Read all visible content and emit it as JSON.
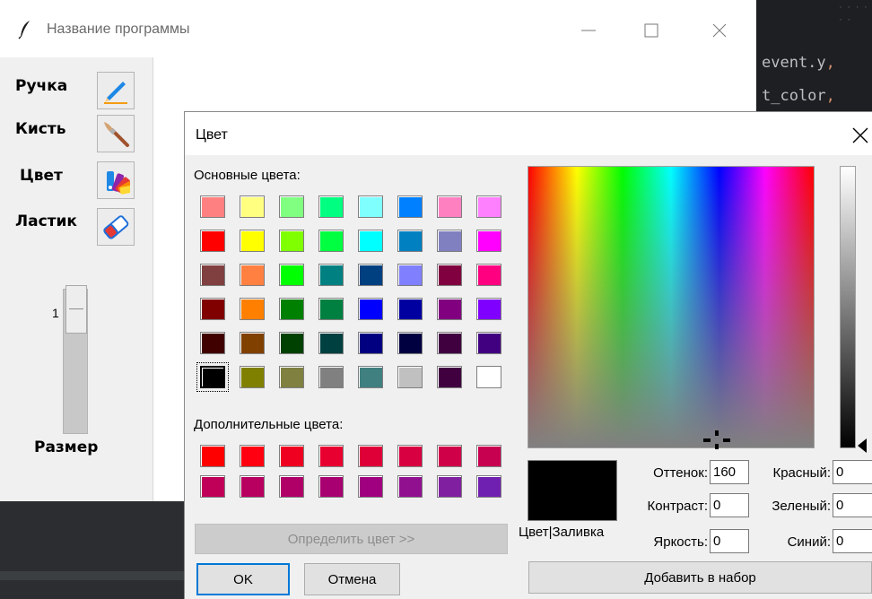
{
  "editor": {
    "line1": "event.y",
    "line2": "t_color",
    "comma": ","
  },
  "app": {
    "title": "Название программы",
    "tools": [
      {
        "label": "Ручка",
        "icon": "pen-icon"
      },
      {
        "label": "Кисть",
        "icon": "brush-icon"
      },
      {
        "label": "Цвет",
        "icon": "palette-icon"
      },
      {
        "label": "Ластик",
        "icon": "eraser-icon"
      }
    ],
    "size_value": "1",
    "size_label": "Размер"
  },
  "dialog": {
    "title": "Цвет",
    "basic_label": "Основные цвета:",
    "custom_label": "Дополнительные цвета:",
    "basic_colors": [
      [
        "#ff8080",
        "#ffff80",
        "#80ff80",
        "#00ff80",
        "#80ffff",
        "#0080ff",
        "#ff80c0",
        "#ff80ff"
      ],
      [
        "#ff0000",
        "#ffff00",
        "#80ff00",
        "#00ff40",
        "#00ffff",
        "#0080c0",
        "#8080c0",
        "#ff00ff"
      ],
      [
        "#804040",
        "#ff8040",
        "#00ff00",
        "#008080",
        "#004080",
        "#8080ff",
        "#800040",
        "#ff0080"
      ],
      [
        "#800000",
        "#ff8000",
        "#008000",
        "#008040",
        "#0000ff",
        "#0000a0",
        "#800080",
        "#8000ff"
      ],
      [
        "#400000",
        "#804000",
        "#004000",
        "#004040",
        "#000080",
        "#000040",
        "#400040",
        "#400080"
      ],
      [
        "#000000",
        "#808000",
        "#808040",
        "#808080",
        "#408080",
        "#c0c0c0",
        "#400040",
        "#ffffff"
      ]
    ],
    "custom_colors": [
      [
        "#ff0000",
        "#ff0010",
        "#f00020",
        "#e80030",
        "#e00038",
        "#d80040",
        "#d00048",
        "#c80050"
      ],
      [
        "#c00058",
        "#b80060",
        "#b00068",
        "#a80070",
        "#a00080",
        "#901090",
        "#8020a0",
        "#7020b0"
      ]
    ],
    "define_button": "Определить цвет >>",
    "ok_button": "OK",
    "cancel_button": "Отмена",
    "preview_label": "Цвет|Заливка",
    "add_button": "Добавить в набор",
    "fields": {
      "hue_label": "Оттенок:",
      "hue": "160",
      "sat_label": "Контраст:",
      "sat": "0",
      "lum_label": "Яркость:",
      "lum": "0",
      "red_label": "Красный:",
      "red": "0",
      "green_label": "Зеленый:",
      "green": "0",
      "blue_label": "Синий:",
      "blue": "0"
    }
  }
}
